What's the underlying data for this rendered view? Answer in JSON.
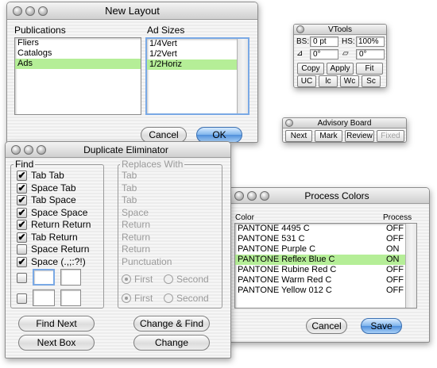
{
  "new_layout": {
    "title": "New Layout",
    "publications_label": "Publications",
    "ad_sizes_label": "Ad Sizes",
    "publications": [
      "Fliers",
      "Catalogs",
      "Ads"
    ],
    "ad_sizes": [
      "1/4Vert",
      "1/2Vert",
      "1/2Horiz"
    ],
    "selected_publication": "Ads",
    "selected_ad_size": "1/2Horiz",
    "cancel_label": "Cancel",
    "ok_label": "OK"
  },
  "vtools": {
    "title": "VTools",
    "bs_label": "BS:",
    "bs_value": "0 pt",
    "hs_label": "HS:",
    "hs_value": "100%",
    "angle_value": "0°",
    "skew_value": "0°",
    "buttons_row1": [
      "Copy",
      "Apply",
      "Fit"
    ],
    "buttons_row2": [
      "UC",
      "lc",
      "Wc",
      "Sc"
    ]
  },
  "advisory_board": {
    "title": "Advisory Board",
    "buttons": [
      "Next",
      "Mark",
      "Review",
      "Fixed"
    ]
  },
  "duplicate_eliminator": {
    "title": "Duplicate Eliminator",
    "find_label": "Find",
    "replaces_label": "Replaces With",
    "items": [
      {
        "find": "Tab Tab",
        "replace": "Tab",
        "checked": true
      },
      {
        "find": "Space Tab",
        "replace": "Tab",
        "checked": true
      },
      {
        "find": "Tab Space",
        "replace": "Tab",
        "checked": true
      },
      {
        "find": "Space Space",
        "replace": "Space",
        "checked": true
      },
      {
        "find": "Return Return",
        "replace": "Return",
        "checked": true
      },
      {
        "find": "Tab Return",
        "replace": "Return",
        "checked": true
      },
      {
        "find": "Space Return",
        "replace": "Return",
        "checked": false
      },
      {
        "find": "Space (.,;:?!)",
        "replace": "Punctuation",
        "checked": true
      }
    ],
    "first_label": "First",
    "second_label": "Second",
    "find_next_label": "Find Next",
    "change_find_label": "Change & Find",
    "next_box_label": "Next Box",
    "change_label": "Change"
  },
  "process_colors": {
    "title": "Process Colors",
    "color_header": "Color",
    "process_header": "Process",
    "rows": [
      {
        "color": "PANTONE 4495 C",
        "process": "OFF"
      },
      {
        "color": "PANTONE 531 C",
        "process": "OFF"
      },
      {
        "color": "PANTONE Purple C",
        "process": "ON"
      },
      {
        "color": "PANTONE Reflex Blue C",
        "process": "ON"
      },
      {
        "color": "PANTONE Rubine Red C",
        "process": "OFF"
      },
      {
        "color": "PANTONE Warm Red C",
        "process": "OFF"
      },
      {
        "color": "PANTONE Yellow 012 C",
        "process": "OFF"
      }
    ],
    "selected_color": "PANTONE Reflex Blue C",
    "cancel_label": "Cancel",
    "save_label": "Save"
  },
  "colors": {
    "selection": "#b5ee97",
    "default_button": "#6aa6e8"
  }
}
